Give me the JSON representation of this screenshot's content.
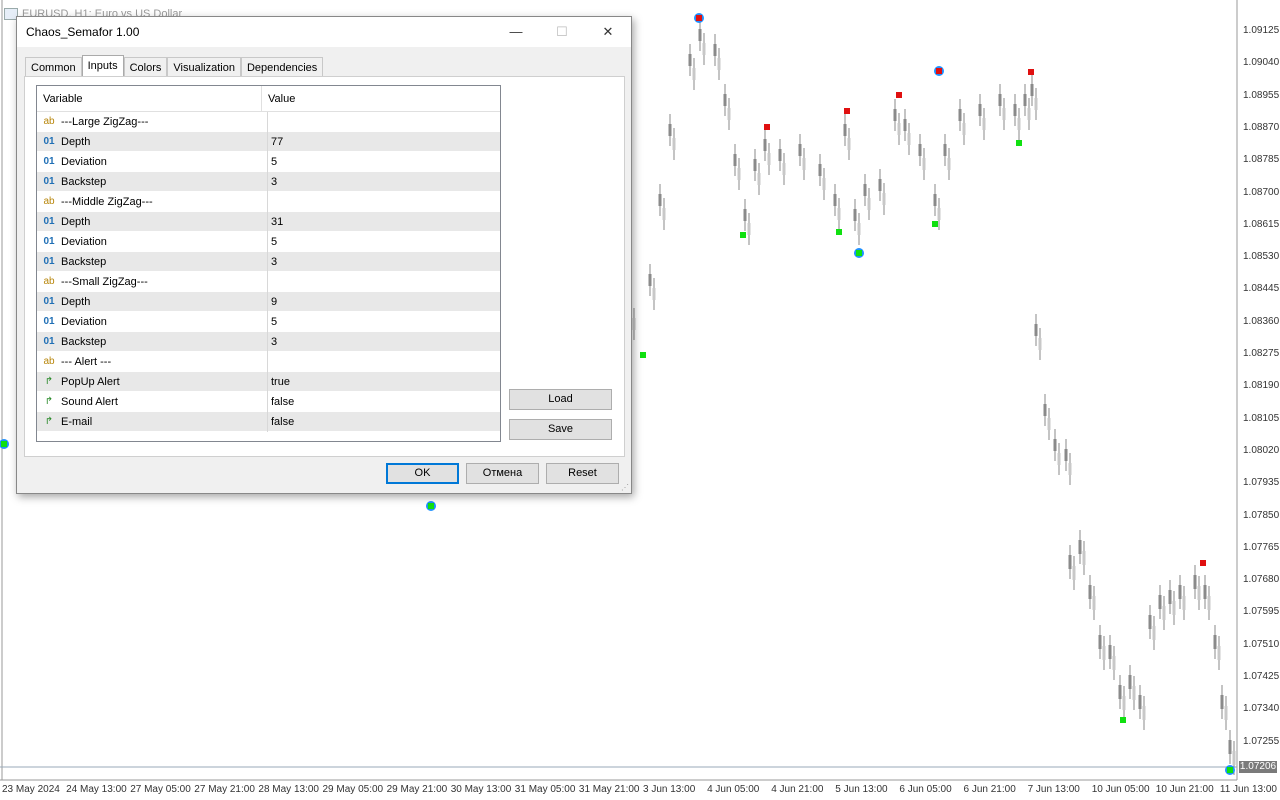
{
  "chart": {
    "window_title": "EURUSD, H1:  Euro vs US Dollar",
    "current_price": "1.07206",
    "price_labels": [
      "1.09125",
      "1.09040",
      "1.08955",
      "1.08870",
      "1.08785",
      "1.08700",
      "1.08615",
      "1.08530",
      "1.08445",
      "1.08360",
      "1.08275",
      "1.08190",
      "1.08105",
      "1.08020",
      "1.07935",
      "1.07850",
      "1.07765",
      "1.07680",
      "1.07595",
      "1.07510",
      "1.07425",
      "1.07340",
      "1.07255"
    ],
    "time_labels": [
      "23 May 2024",
      "24 May 13:00",
      "27 May 05:00",
      "27 May 21:00",
      "28 May 13:00",
      "29 May 05:00",
      "29 May 21:00",
      "30 May 13:00",
      "31 May 05:00",
      "31 May 21:00",
      "3 Jun 13:00",
      "4 Jun 05:00",
      "4 Jun 21:00",
      "5 Jun 13:00",
      "6 Jun 05:00",
      "6 Jun 21:00",
      "7 Jun 13:00",
      "10 Jun 05:00",
      "10 Jun 21:00",
      "11 Jun 13:00"
    ],
    "colors": {
      "candle": "#8a8a8a",
      "semaphore_high": "#e01010",
      "semaphore_low": "#10e010",
      "circle": "#1e90ff"
    }
  },
  "dialog": {
    "title": "Chaos_Semafor 1.00",
    "controls": {
      "minimize": "—",
      "maximize": "☐",
      "close": "✕"
    },
    "tabs": [
      {
        "label": "Common",
        "active": false
      },
      {
        "label": "Inputs",
        "active": true
      },
      {
        "label": "Colors",
        "active": false
      },
      {
        "label": "Visualization",
        "active": false
      },
      {
        "label": "Dependencies",
        "active": false
      }
    ],
    "grid": {
      "headers": {
        "variable": "Variable",
        "value": "Value"
      },
      "rows": [
        {
          "type": "ab",
          "variable": "---Large ZigZag---",
          "value": ""
        },
        {
          "type": "01",
          "variable": "Depth",
          "value": "77"
        },
        {
          "type": "01",
          "variable": "Deviation",
          "value": "5"
        },
        {
          "type": "01",
          "variable": "Backstep",
          "value": "3"
        },
        {
          "type": "ab",
          "variable": "---Middle ZigZag---",
          "value": ""
        },
        {
          "type": "01",
          "variable": "Depth",
          "value": "31"
        },
        {
          "type": "01",
          "variable": "Deviation",
          "value": "5"
        },
        {
          "type": "01",
          "variable": "Backstep",
          "value": "3"
        },
        {
          "type": "ab",
          "variable": "---Small ZigZag---",
          "value": ""
        },
        {
          "type": "01",
          "variable": "Depth",
          "value": "9"
        },
        {
          "type": "01",
          "variable": "Deviation",
          "value": "5"
        },
        {
          "type": "01",
          "variable": "Backstep",
          "value": "3"
        },
        {
          "type": "ab",
          "variable": "---   Alert   ---",
          "value": ""
        },
        {
          "type": "bool",
          "variable": "PopUp Alert",
          "value": "true"
        },
        {
          "type": "bool",
          "variable": "Sound Alert",
          "value": "false"
        },
        {
          "type": "bool",
          "variable": "E-mail",
          "value": "false"
        }
      ]
    },
    "type_icons": {
      "ab": "ab",
      "01": "01",
      "bool": "↱"
    },
    "buttons": {
      "load": "Load",
      "save": "Save",
      "ok": "OK",
      "cancel": "Отмена",
      "reset": "Reset"
    }
  }
}
